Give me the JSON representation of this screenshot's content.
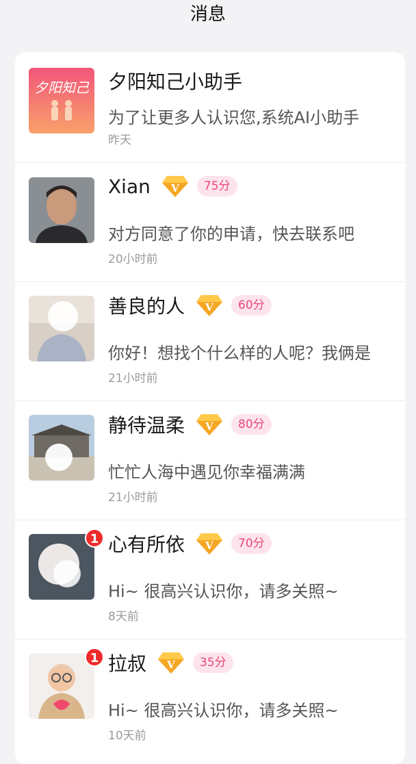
{
  "header": {
    "title": "消息"
  },
  "conversations": [
    {
      "name": "夕阳知己小助手",
      "message": "为了让更多人认识您,系统AI小助手",
      "time": "昨天",
      "vip": false,
      "score": null,
      "unread": null,
      "avatar_logo_text": "夕阳知己"
    },
    {
      "name": "Xian",
      "message": "对方同意了你的申请，快去联系吧",
      "time": "20小时前",
      "vip": true,
      "score": "75分",
      "unread": null
    },
    {
      "name": "善良的人",
      "message": "你好！想找个什么样的人呢？我俩是",
      "time": "21小时前",
      "vip": true,
      "score": "60分",
      "unread": null
    },
    {
      "name": "静待温柔",
      "message": "忙忙人海中遇见你幸福满满",
      "time": "21小时前",
      "vip": true,
      "score": "80分",
      "unread": null
    },
    {
      "name": "心有所依",
      "message": "Hi~ 很高兴认识你，请多关照~",
      "time": "8天前",
      "vip": true,
      "score": "70分",
      "unread": "1"
    },
    {
      "name": "拉叔",
      "message": "Hi~ 很高兴认识你，请多关照~",
      "time": "10天前",
      "vip": true,
      "score": "35分",
      "unread": "1"
    }
  ],
  "icons": {
    "vip": "vip-diamond-icon"
  },
  "colors": {
    "score_text": "#e84877",
    "score_bg": "#fde4ec",
    "vip_gold": "#f5a623",
    "unread_badge": "#ee2b2b",
    "assistant_bg": "#f77d7a"
  }
}
